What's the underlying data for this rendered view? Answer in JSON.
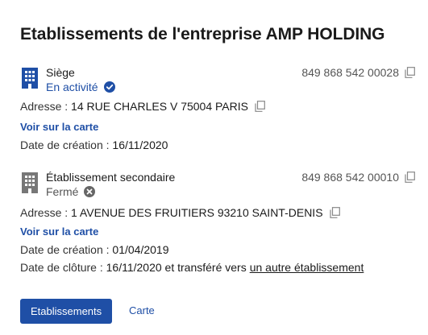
{
  "page": {
    "title": "Etablissements de l'entreprise AMP HOLDING"
  },
  "colors": {
    "accent": "#1f4fa6",
    "active_icon": "#1f4fa6",
    "closed_icon": "#777777",
    "text": "#333333"
  },
  "establishments": [
    {
      "name": "Siège",
      "icon": "building-icon",
      "status": "En activité",
      "status_icon": "check-circle-icon",
      "siret": "849 868 542 00028",
      "address_label": "Adresse :",
      "address": "14 RUE CHARLES V 75004 PARIS",
      "map_link": "Voir sur la carte",
      "creation_label": "Date de création :",
      "creation_date": "16/11/2020"
    },
    {
      "name": "Établissement secondaire",
      "icon": "building-icon",
      "status": "Fermé",
      "status_icon": "close-circle-icon",
      "siret": "849 868 542 00010",
      "address_label": "Adresse :",
      "address": "1 AVENUE DES FRUITIERS 93210 SAINT-DENIS",
      "map_link": "Voir sur la carte",
      "creation_label": "Date de création :",
      "creation_date": "01/04/2019",
      "closure_label": "Date de clôture :",
      "closure_date": "16/11/2020",
      "transfer_text": "et transféré vers",
      "transfer_link": "un autre établissement"
    }
  ],
  "actions": {
    "primary_label": "Etablissements",
    "secondary_label": "Carte"
  }
}
